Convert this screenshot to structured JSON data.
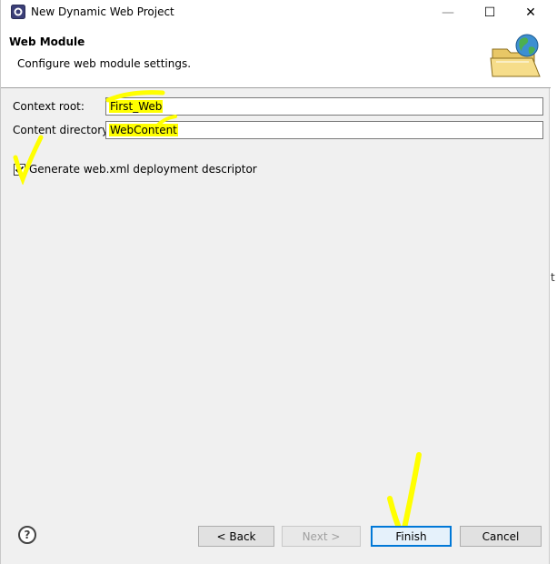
{
  "window": {
    "title": "New Dynamic Web Project",
    "controls": {
      "minimize": "—",
      "maximize": "☐",
      "close": "✕"
    }
  },
  "banner": {
    "title": "Web Module",
    "description": "Configure web module settings.",
    "icon": "folder-globe-icon"
  },
  "form": {
    "context_root": {
      "label": "Context root:",
      "value": "First_Web"
    },
    "content_directory": {
      "label": "Content directory:",
      "value": "WebContent"
    },
    "generate_descriptor": {
      "label": "Generate web.xml deployment descriptor",
      "checked": true
    }
  },
  "footer": {
    "help": "?",
    "back": "< Back",
    "next": "Next >",
    "finish": "Finish",
    "cancel": "Cancel"
  },
  "colors": {
    "highlight": "#ffff00",
    "default_button_border": "#0078d7"
  }
}
